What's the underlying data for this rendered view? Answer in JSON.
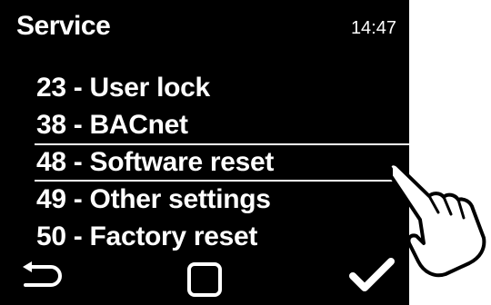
{
  "header": {
    "title": "Service",
    "time": "14:47"
  },
  "menu": {
    "items": [
      {
        "label": "23 - User lock"
      },
      {
        "label": "38 - BACnet"
      },
      {
        "label": "48 - Software reset",
        "selected": true
      },
      {
        "label": "49 - Other settings"
      },
      {
        "label": "50 - Factory reset"
      }
    ]
  },
  "softkeys": {
    "back_icon": "back-arrow-icon",
    "home_icon": "square-icon",
    "ok_icon": "checkmark-icon"
  },
  "overlay": {
    "pointer_icon": "pointing-hand-icon"
  }
}
